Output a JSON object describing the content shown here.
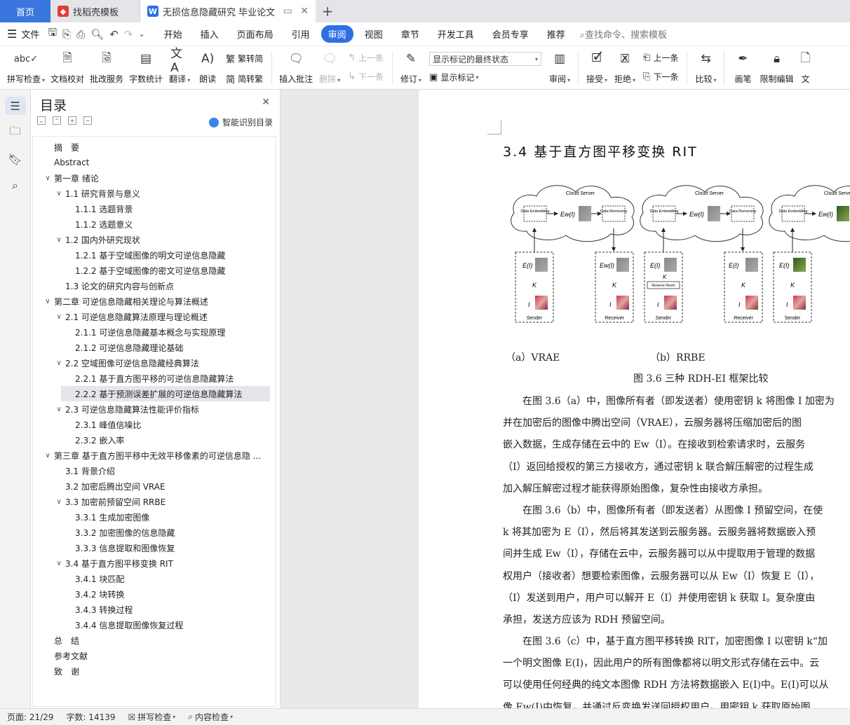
{
  "tabs": {
    "home": "首页",
    "template": "找稻壳模板",
    "doc": "无损信息隐藏研究 毕业论文",
    "add": "+"
  },
  "menubar": {
    "file": "文件",
    "items": [
      "开始",
      "插入",
      "页面布局",
      "引用",
      "审阅",
      "视图",
      "章节",
      "开发工具",
      "会员专享",
      "推荐"
    ],
    "active": "审阅",
    "search": "查找命令、搜索模板"
  },
  "ribbon": {
    "spell": "拼写检查",
    "proof": "文档校对",
    "batch": "批改服务",
    "wordcount": "字数统计",
    "translate": "翻译",
    "read": "朗读",
    "trad": "繁转简",
    "simp": "简转繁",
    "insert_comment": "插入批注",
    "delete": "删除",
    "prev": "上一条",
    "next": "下一条",
    "revise": "修订",
    "markup_state": "显示标记的最终状态",
    "show_markup": "显示标记",
    "review": "审阅",
    "accept": "接受",
    "reject": "拒绝",
    "prev2": "上一条",
    "next2": "下一条",
    "compare": "比较",
    "pen": "画笔",
    "restrict": "限制编辑",
    "doc_cut": "文"
  },
  "toc": {
    "title": "目录",
    "smart": "智能识别目录",
    "items": [
      "摘　要",
      "Abstract",
      "第一章  绪论",
      "1.1  研究背景与意义",
      "1.1.1 选题背景",
      "1.1.2 选题意义",
      "1.2  国内外研究现状",
      "1.2.1  基于空域图像的明文可逆信息隐藏",
      "1.2.2  基于空域图像的密文可逆信息隐藏",
      "1.3  论文的研究内容与创新点",
      "第二章  可逆信息隐藏相关理论与算法概述",
      "2.1  可逆信息隐藏算法原理与理论概述",
      "2.1.1  可逆信息隐藏基本概念与实现原理",
      "2.1.2  可逆信息隐藏理论基础",
      "2.2  空域图像可逆信息隐藏经典算法",
      "2.2.1  基于直方图平移的可逆信息隐藏算法",
      "2.2.2  基于预测误差扩展的可逆信息隐藏算法",
      "2.3  可逆信息隐藏算法性能评价指标",
      "2.3.1  峰值信噪比",
      "2.3.2  嵌入率",
      "第三章  基于直方图平移中无效平移像素的可逆信息隐 ...",
      "3.1 背景介绍",
      "3.2 加密后腾出空间 VRAE",
      "3.3 加密前预留空间 RRBE",
      "3.3.1 生成加密图像",
      "3.3.2 加密图像的信息隐藏",
      "3.3.3 信息提取和图像恢复",
      "3.4 基于直方图平移变换 RIT",
      "3.4.1 块匹配",
      "3.4.2 块转换",
      "3.4.3 转换过程",
      "3.4.4 信息提取图像恢复过程",
      "总　结",
      "参考文献",
      "致　谢"
    ]
  },
  "doc": {
    "heading": "3.4 基于直方图平移变换 RIT",
    "figure_labels": {
      "cloud": "Cloud Server",
      "embed": "Data Embedding",
      "removing": "Data Removing",
      "ew": "Ew(I)",
      "ei": "E(I)",
      "k": "K",
      "i": "I",
      "sender": "Sender",
      "receiver": "Receiver",
      "reserve": "Reserve Room"
    },
    "cap_a": "（a）VRAE",
    "cap_b": "（b）RRBE",
    "fig_caption": "图 3.6 三种 RDH-EI 框架比较",
    "paragraphs": [
      "在图 3.6（a）中，图像所有者（即发送者）使用密钥 k 将图像 I 加密为",
      "并在加密后的图像中腾出空间（VRAE），云服务器将压缩加密后的图",
      "嵌入数据，生成存储在云中的 Ew（I）。在接收到检索请求时，云服务",
      "（I）返回给授权的第三方接收方，通过密钥 k 联合解压解密的过程生成",
      "加入解压解密过程才能获得原始图像，复杂性由接收方承担。",
      "在图 3.6（b）中，图像所有者（即发送者）从图像 I 预留空间，在使",
      "k 将其加密为 E（I），然后将其发送到云服务器。云服务器将数据嵌入预",
      "间并生成 Ew（I），存储在云中，云服务器可以从中提取用于管理的数据",
      "权用户（接收者）想要检索图像，云服务器可以从 Ew（I）恢复 E（I），",
      "（I）发送到用户，用户可以解开 E（I）并使用密钥 k 获取 I。复杂度由",
      "承担，发送方应该为 RDH 预留空间。",
      "在图 3.6（c）中，基于直方图平移转换 RIT，加密图像 I 以密钥 k“加",
      "一个明文图像 E(I)，因此用户的所有图像都将以明文形式存储在云中。云",
      "可以使用任何经典的纯文本图像 RDH 方法将数据嵌入 E(I)中。E(I)可以从",
      "像 Ew(I)中恢复，并通过反变换发送回授权用户。用密钥 k 获取原始图"
    ]
  },
  "status": {
    "page": "页面: 21/29",
    "words": "字数: 14139",
    "spell": "拼写检查",
    "content": "内容检查"
  }
}
